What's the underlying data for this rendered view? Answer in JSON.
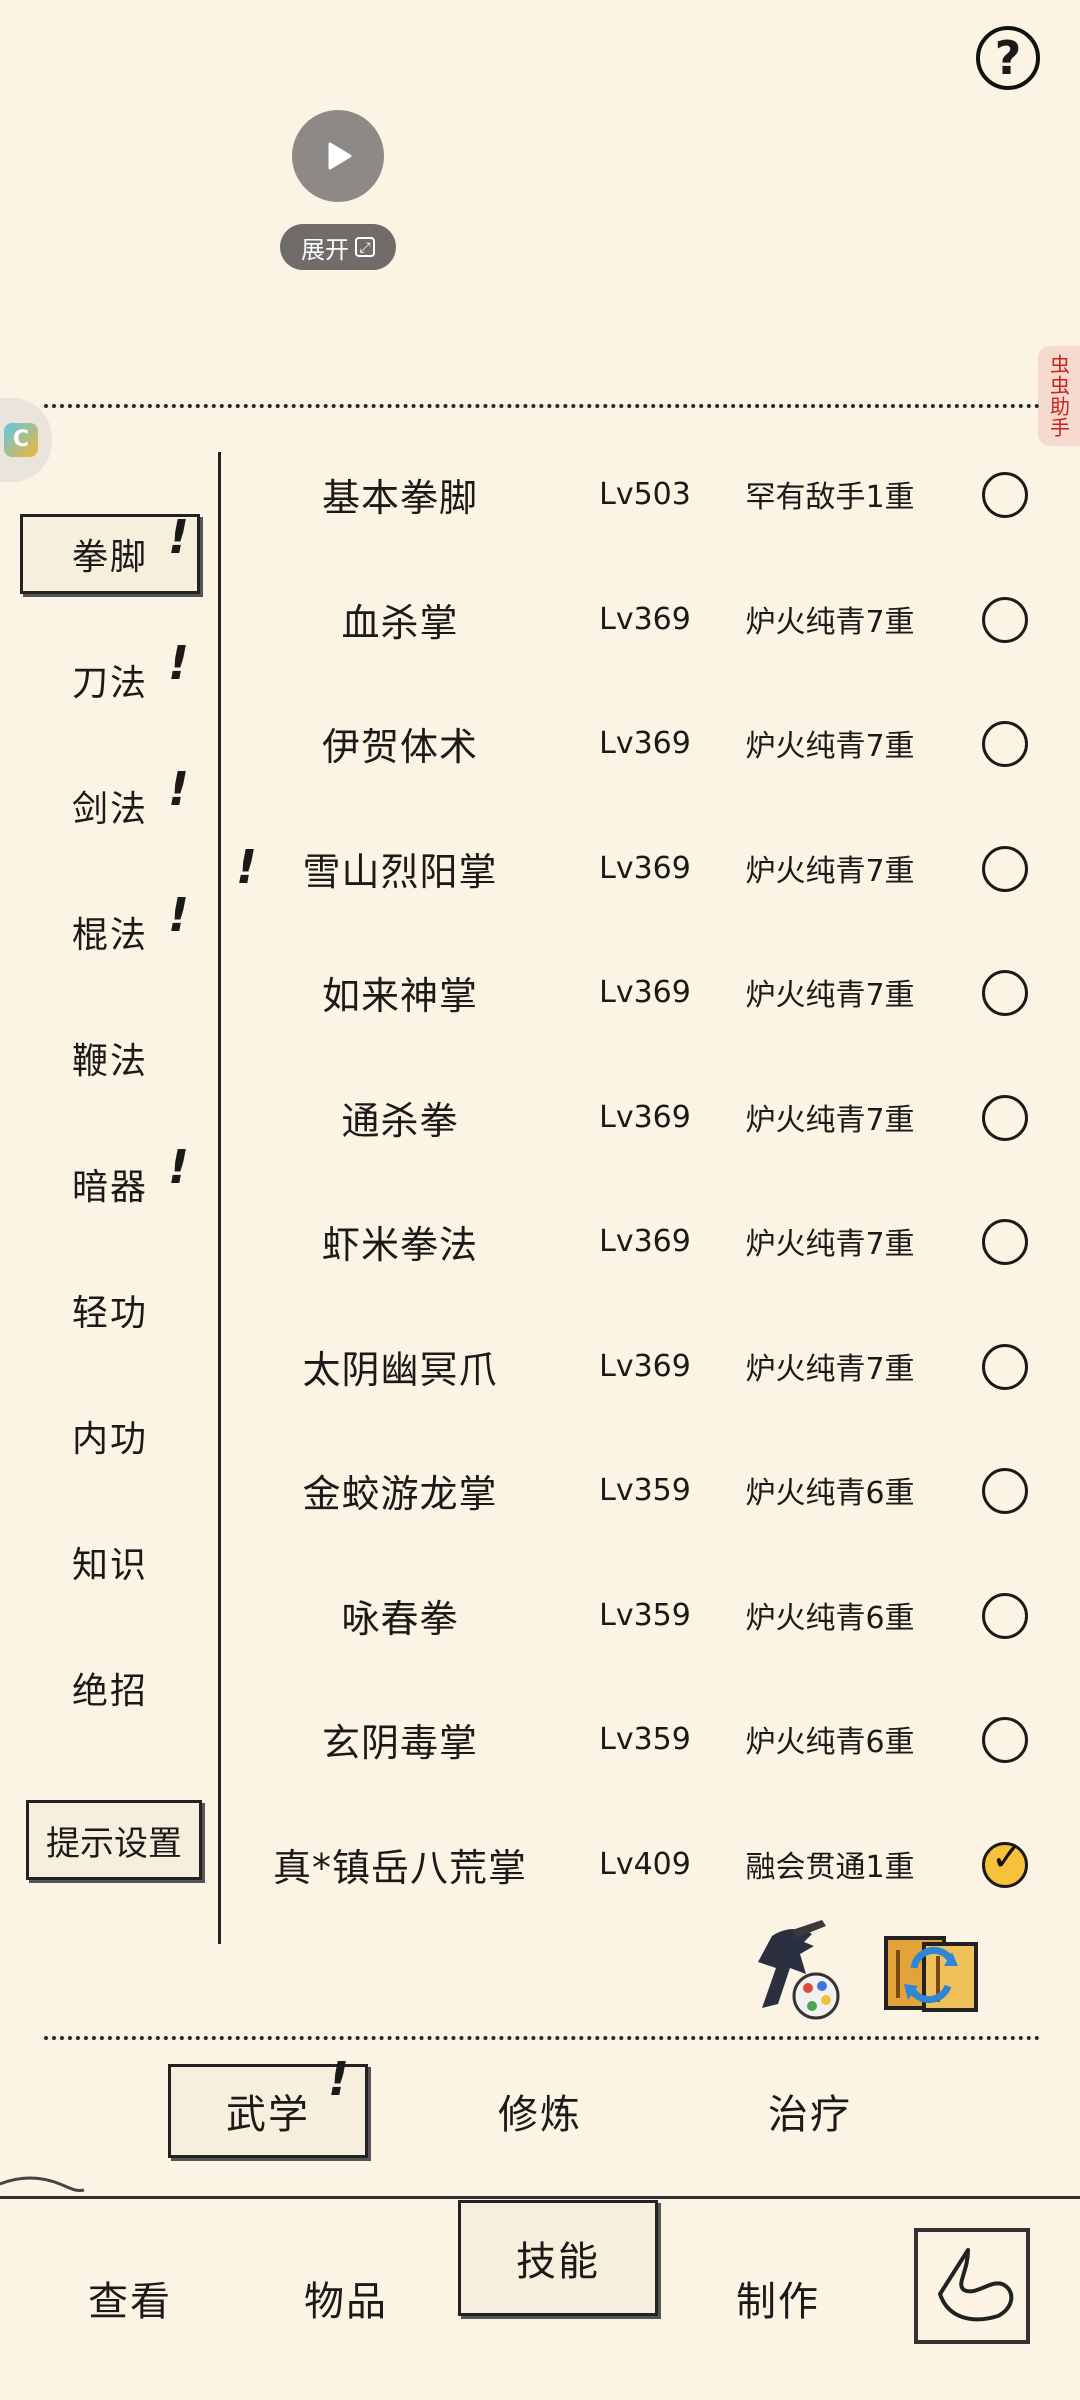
{
  "top": {
    "help_icon": "question-mark",
    "expand_label": "展开",
    "assistant_label": "虫虫助手"
  },
  "categories": [
    {
      "label": "拳脚",
      "alert": true,
      "active": true
    },
    {
      "label": "刀法",
      "alert": true
    },
    {
      "label": "剑法",
      "alert": true
    },
    {
      "label": "棍法",
      "alert": true
    },
    {
      "label": "鞭法",
      "alert": false
    },
    {
      "label": "暗器",
      "alert": true
    },
    {
      "label": "轻功",
      "alert": false
    },
    {
      "label": "内功",
      "alert": false
    },
    {
      "label": "知识",
      "alert": false
    },
    {
      "label": "绝招",
      "alert": false
    }
  ],
  "hint_settings_label": "提示设置",
  "skills": [
    {
      "name": "基本拳脚",
      "level": "Lv503",
      "realm": "罕有敌手1重",
      "checked": false
    },
    {
      "name": "血杀掌",
      "level": "Lv369",
      "realm": "炉火纯青7重",
      "checked": false
    },
    {
      "name": "伊贺体术",
      "level": "Lv369",
      "realm": "炉火纯青7重",
      "checked": false
    },
    {
      "name": "雪山烈阳掌",
      "level": "Lv369",
      "realm": "炉火纯青7重",
      "checked": false,
      "alert": true
    },
    {
      "name": "如来神掌",
      "level": "Lv369",
      "realm": "炉火纯青7重",
      "checked": false
    },
    {
      "name": "通杀拳",
      "level": "Lv369",
      "realm": "炉火纯青7重",
      "checked": false
    },
    {
      "name": "虾米拳法",
      "level": "Lv369",
      "realm": "炉火纯青7重",
      "checked": false
    },
    {
      "name": "太阴幽冥爪",
      "level": "Lv369",
      "realm": "炉火纯青7重",
      "checked": false
    },
    {
      "name": "金蛟游龙掌",
      "level": "Lv359",
      "realm": "炉火纯青6重",
      "checked": false
    },
    {
      "name": "咏春拳",
      "level": "Lv359",
      "realm": "炉火纯青6重",
      "checked": false
    },
    {
      "name": "玄阴毒掌",
      "level": "Lv359",
      "realm": "炉火纯青6重",
      "checked": false
    },
    {
      "name": "真*镇岳八荒掌",
      "level": "Lv409",
      "realm": "融会贯通1重",
      "checked": true
    }
  ],
  "sub_tabs": [
    {
      "label": "武学",
      "active": true,
      "alert": true
    },
    {
      "label": "修炼",
      "active": false
    },
    {
      "label": "治疗",
      "active": false
    }
  ],
  "nav_tabs": [
    {
      "label": "查看",
      "active": false
    },
    {
      "label": "物品",
      "active": false
    },
    {
      "label": "技能",
      "active": true
    },
    {
      "label": "制作",
      "active": false
    }
  ],
  "alert_mark": "!",
  "colors": {
    "background": "#fbf3e3",
    "check_on": "#f7c13c",
    "assistant_text": "#c8241a"
  }
}
